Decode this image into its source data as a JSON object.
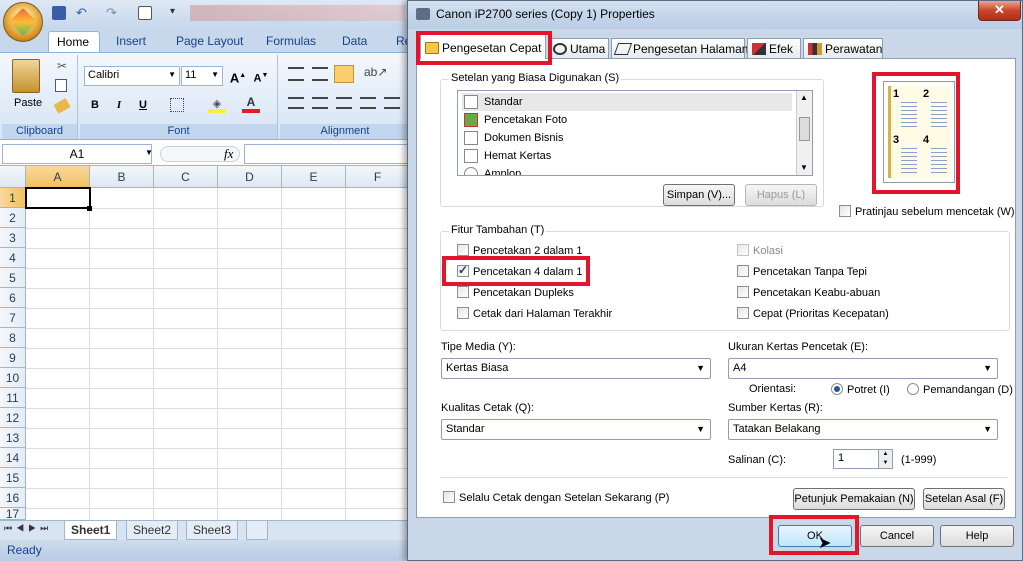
{
  "excel": {
    "tabs": [
      "Home",
      "Insert",
      "Page Layout",
      "Formulas",
      "Data",
      "Re"
    ],
    "groups": [
      "Clipboard",
      "Font",
      "Alignment"
    ],
    "paste_label": "Paste",
    "font_name": "Calibri",
    "font_size": "11",
    "name_box": "A1",
    "fx": "fx",
    "columns": [
      "A",
      "B",
      "C",
      "D",
      "E",
      "F"
    ],
    "rows": [
      "1",
      "2",
      "3",
      "4",
      "5",
      "6",
      "7",
      "8",
      "9",
      "10",
      "11",
      "12",
      "13",
      "14",
      "15",
      "16",
      "17"
    ],
    "sheets": [
      "Sheet1",
      "Sheet2",
      "Sheet3"
    ],
    "status": "Ready"
  },
  "dialog": {
    "title": "Canon iP2700 series (Copy 1) Properties",
    "close": "✕",
    "tabs": [
      "Pengesetan Cepat",
      "Utama",
      "Pengesetan Halaman",
      "Efek",
      "Perawatan"
    ],
    "common_label": "Setelan yang Biasa Digunakan (S)",
    "common_items": [
      "Standar",
      "Pencetakan Foto",
      "Dokumen Bisnis",
      "Hemat Kertas",
      "Amplop"
    ],
    "save_btn": "Simpan (V)...",
    "delete_btn": "Hapus (L)",
    "preview_label": "Pratinjau sebelum mencetak (W)",
    "preview_pages": [
      "1",
      "2",
      "3",
      "4"
    ],
    "features_label": "Fitur Tambahan (T)",
    "features_left": [
      "Pencetakan 2 dalam 1",
      "Pencetakan 4 dalam 1",
      "Pencetakan Dupleks",
      "Cetak dari Halaman Terakhir"
    ],
    "features_right": [
      "Kolasi",
      "Pencetakan Tanpa Tepi",
      "Pencetakan Keabu-abuan",
      "Cepat (Prioritas Kecepatan)"
    ],
    "media_label": "Tipe Media (Y):",
    "media_value": "Kertas Biasa",
    "paper_size_label": "Ukuran Kertas Pencetak (E):",
    "paper_size_value": "A4",
    "orientation_label": "Orientasi:",
    "portrait": "Potret (I)",
    "landscape": "Pemandangan (D)",
    "quality_label": "Kualitas Cetak (Q):",
    "quality_value": "Standar",
    "source_label": "Sumber Kertas (R):",
    "source_value": "Tatakan Belakang",
    "copies_label": "Salinan (C):",
    "copies_value": "1",
    "copies_range": "(1-999)",
    "always_print": "Selalu Cetak dengan Setelan Sekarang (P)",
    "instructions_btn": "Petunjuk Pemakaian (N)",
    "defaults_btn": "Setelan Asal (F)",
    "ok": "OK",
    "cancel": "Cancel",
    "help": "Help"
  }
}
